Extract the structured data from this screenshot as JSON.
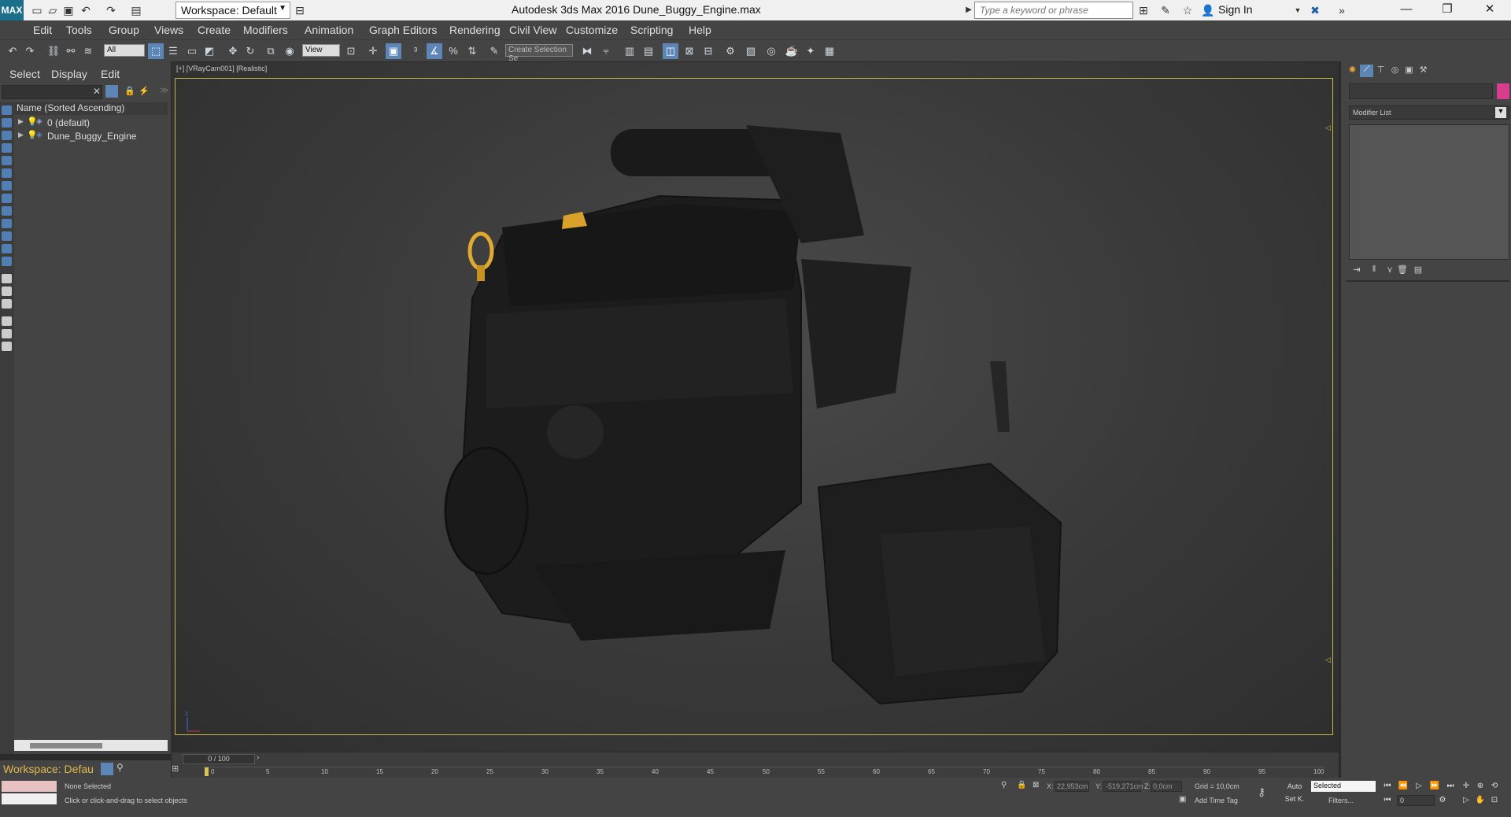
{
  "titlebar": {
    "logo": "MAX",
    "workspace": "Workspace: Default",
    "title": "Autodesk 3ds Max 2016     Dune_Buggy_Engine.max",
    "search_placeholder": "Type a keyword or phrase",
    "sign_in": "Sign In"
  },
  "menu": [
    "Edit",
    "Tools",
    "Group",
    "Views",
    "Create",
    "Modifiers",
    "Animation",
    "Graph Editors",
    "Rendering",
    "Civil View",
    "Customize",
    "Scripting",
    "Help"
  ],
  "toolbar": {
    "filter_value": "All",
    "refcoord_value": "View",
    "selection_set_value": "Create Selection Se"
  },
  "explorer": {
    "tabs": [
      "Select",
      "Display",
      "Edit"
    ],
    "header": "Name (Sorted Ascending)",
    "rows": [
      "0 (default)",
      "Dune_Buggy_Engine"
    ],
    "workspace_label": "Workspace: Defau"
  },
  "viewport": {
    "label": "[+] [VRayCam001] [Realistic]"
  },
  "command_panel": {
    "modifier_list": "Modifier List"
  },
  "timeline": {
    "slider": "0 / 100",
    "ticks": [
      "0",
      "5",
      "10",
      "15",
      "20",
      "25",
      "30",
      "35",
      "40",
      "45",
      "50",
      "55",
      "60",
      "65",
      "70",
      "75",
      "80",
      "85",
      "90",
      "95",
      "100"
    ]
  },
  "status": {
    "selection": "None Selected",
    "prompt": "Click or click-and-drag to select objects",
    "x_label": "X:",
    "x_value": "22,953cm",
    "y_label": "Y:",
    "y_value": "-519,271cm",
    "z_label": "Z:",
    "z_value": "0,0cm",
    "grid": "Grid = 10,0cm",
    "add_time_tag": "Add Time Tag",
    "auto": "Auto",
    "set_key": "Set K.",
    "selected": "Selected",
    "filters": "Filters...",
    "frame": "0"
  },
  "colors": {
    "accent": "#5d86b6",
    "viewport_border": "#c7b64c",
    "object_color": "#d63d8c",
    "dipstick": "#e0a930"
  }
}
